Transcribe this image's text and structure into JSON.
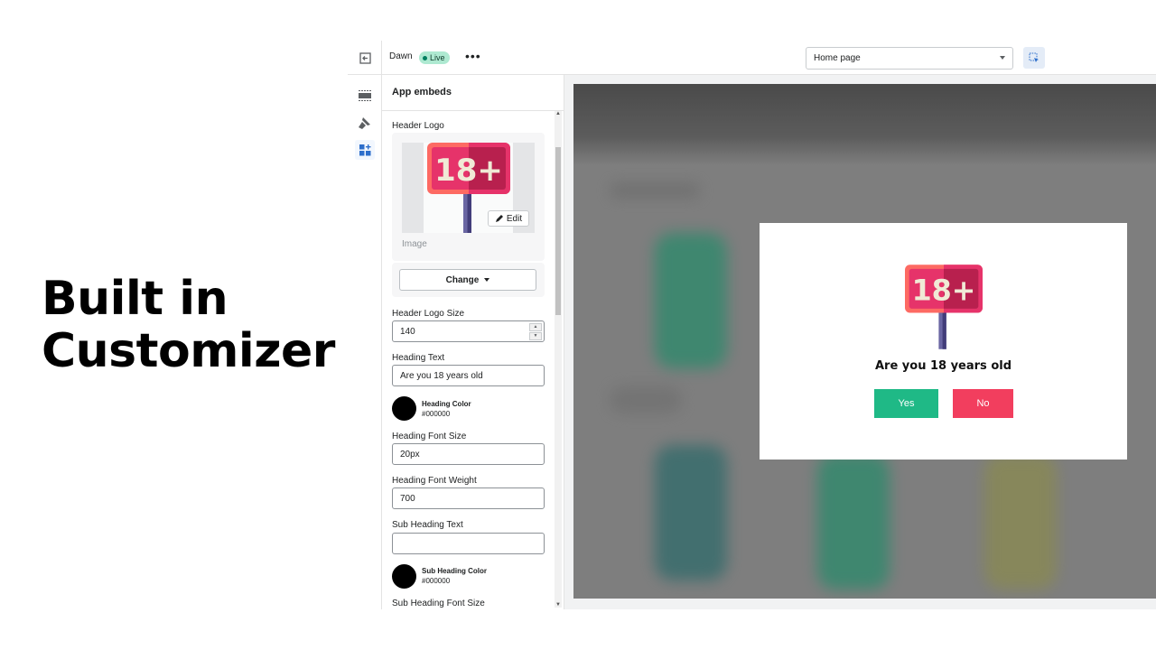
{
  "hero": {
    "line1": "Built in",
    "line2": "Customizer"
  },
  "topbar": {
    "theme_name": "Dawn",
    "status_badge": "Live",
    "more_label": "•••",
    "page_select": "Home page"
  },
  "panel": {
    "title": "App embeds",
    "header_logo_label": "Header Logo",
    "image_label": "Image",
    "edit_label": "Edit",
    "change_label": "Change",
    "fields": {
      "logo_size_label": "Header Logo Size",
      "logo_size_value": "140",
      "heading_text_label": "Heading Text",
      "heading_text_value": "Are you 18 years old",
      "heading_color_label": "Heading Color",
      "heading_color_value": "#000000",
      "heading_font_size_label": "Heading Font Size",
      "heading_font_size_value": "20px",
      "heading_font_weight_label": "Heading Font Weight",
      "heading_font_weight_value": "700",
      "sub_heading_text_label": "Sub Heading Text",
      "sub_heading_text_value": "",
      "sub_heading_color_label": "Sub Heading Color",
      "sub_heading_color_value": "#000000",
      "sub_heading_font_size_label": "Sub Heading Font Size"
    }
  },
  "logo": {
    "text": "18+"
  },
  "modal": {
    "heading": "Are you 18 years old",
    "yes_label": "Yes",
    "no_label": "No"
  },
  "colors": {
    "yes": "#1fb986",
    "no": "#f23e5e",
    "accent": "#2c6ecb"
  }
}
